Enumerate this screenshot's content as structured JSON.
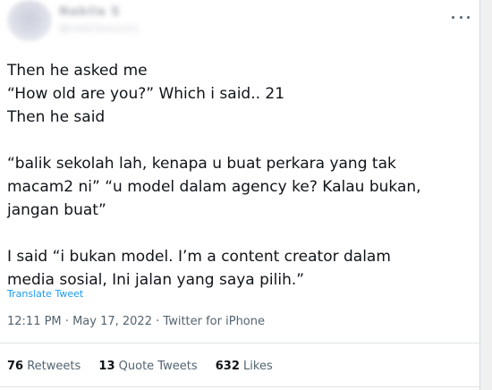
{
  "author": {
    "name": "Nabila S",
    "handle": "@nabilaxxxxx"
  },
  "tweet": {
    "lines": [
      "Then he asked me",
      "“How old are you?” Which i said.. 21",
      "Then he said",
      "“balik sekolah lah, kenapa u buat perkara yang tak",
      "macam2 ni” “u model dalam agency ke? Kalau bukan,",
      "jangan buat”",
      "I said “i bukan model. I’m a content creator dalam",
      "media sosial, Ini jalan yang saya pilih.”"
    ],
    "translate_label": "Translate Tweet"
  },
  "meta": {
    "time": "12:11 PM",
    "separator": "·",
    "date": "May 17, 2022",
    "source": "Twitter for iPhone"
  },
  "stats": {
    "retweets_count": "76",
    "retweets_label": "Retweets",
    "quotes_count": "13",
    "quotes_label": "Quote Tweets",
    "likes_count": "632",
    "likes_label": "Likes"
  },
  "icons": {
    "more": "more-horizontal-icon"
  },
  "colors": {
    "text": "#0f1419",
    "secondary": "#536471",
    "link": "#1d9bf0",
    "border": "#dde3e7"
  }
}
